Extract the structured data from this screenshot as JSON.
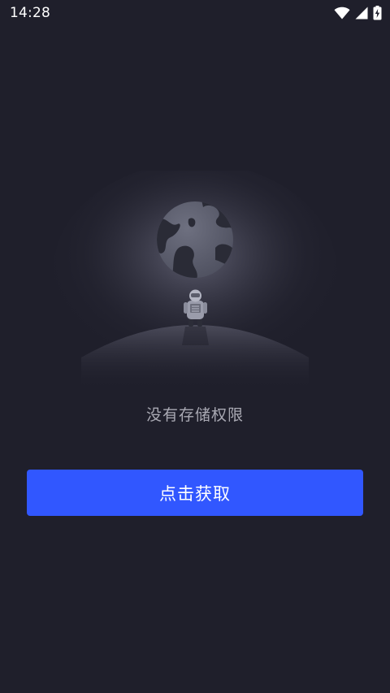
{
  "status_bar": {
    "time": "14:28",
    "icons": [
      "wifi-icon",
      "cellular-signal-icon",
      "battery-charging-icon"
    ]
  },
  "empty_state": {
    "illustration": "astronaut-planet-illustration",
    "message": "没有存储权限"
  },
  "action": {
    "label": "点击获取"
  },
  "colors": {
    "background": "#1f1f2b",
    "accent": "#3157ff",
    "message_text": "#a9a9b3",
    "button_text": "#ffffff"
  }
}
